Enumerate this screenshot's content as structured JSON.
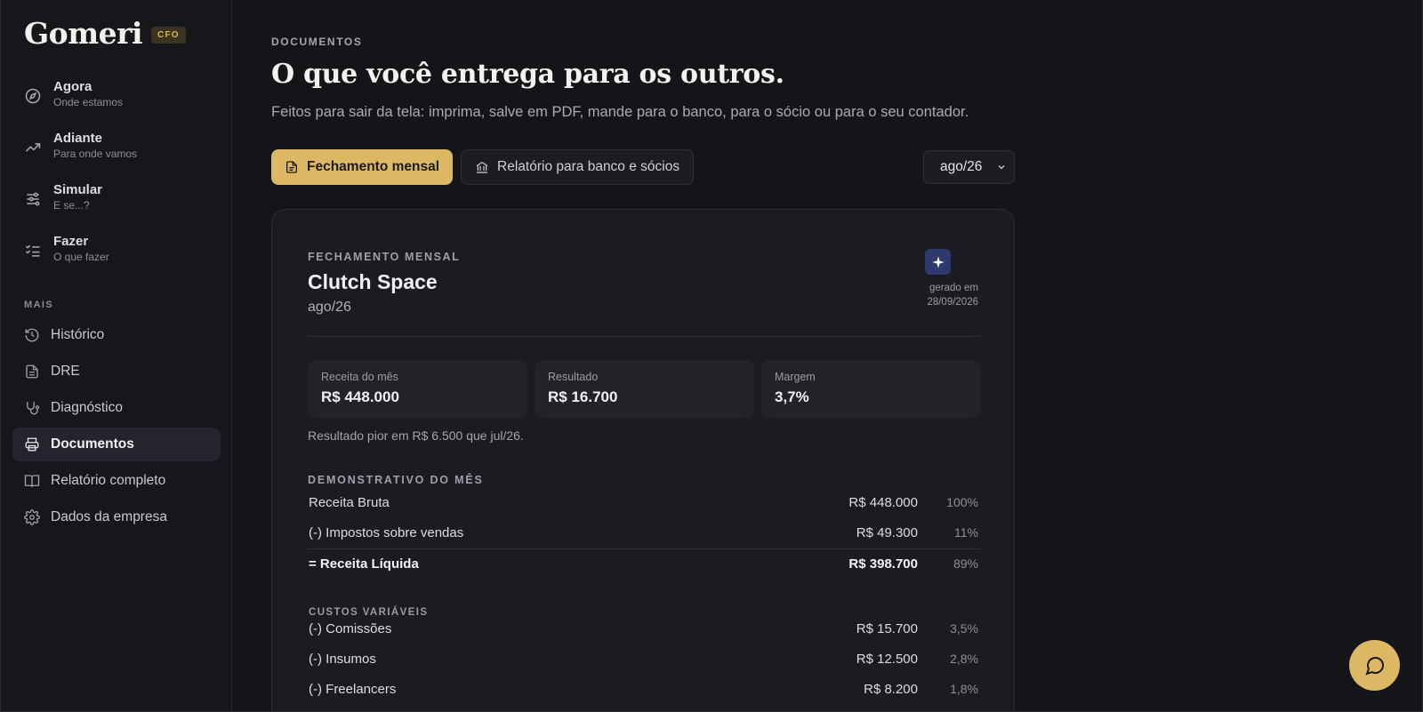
{
  "brand": {
    "name": "Gomeri",
    "badge": "CFO"
  },
  "nav_main": [
    {
      "title": "Agora",
      "subtitle": "Onde estamos",
      "icon": "compass-icon"
    },
    {
      "title": "Adiante",
      "subtitle": "Para onde vamos",
      "icon": "trending-up-icon"
    },
    {
      "title": "Simular",
      "subtitle": "E se...?",
      "icon": "sliders-icon"
    },
    {
      "title": "Fazer",
      "subtitle": "O que fazer",
      "icon": "checklist-icon"
    }
  ],
  "nav_section_label": "MAIS",
  "nav_secondary": [
    {
      "label": "Histórico",
      "icon": "history-icon",
      "active": false
    },
    {
      "label": "DRE",
      "icon": "file-text-icon",
      "active": false
    },
    {
      "label": "Diagnóstico",
      "icon": "stethoscope-icon",
      "active": false
    },
    {
      "label": "Documentos",
      "icon": "printer-icon",
      "active": true
    },
    {
      "label": "Relatório completo",
      "icon": "book-open-icon",
      "active": false
    },
    {
      "label": "Dados da empresa",
      "icon": "gear-icon",
      "active": false
    }
  ],
  "header": {
    "eyebrow": "DOCUMENTOS",
    "title": "O que você entrega para os outros.",
    "subtitle": "Feitos para sair da tela: imprima, salve em PDF, mande para o banco, para o sócio ou para o seu contador."
  },
  "tabs": [
    {
      "label": "Fechamento mensal",
      "icon": "file-icon",
      "active": true
    },
    {
      "label": "Relatório para banco e sócios",
      "icon": "bank-icon",
      "active": false
    }
  ],
  "month_select": {
    "value": "ago/26"
  },
  "card": {
    "eyebrow": "FECHAMENTO MENSAL",
    "company": "Clutch Space",
    "period": "ago/26",
    "generated_label": "gerado em",
    "generated_date": "28/09/2026",
    "kpis": [
      {
        "label": "Receita do mês",
        "value": "R$ 448.000"
      },
      {
        "label": "Resultado",
        "value": "R$ 16.700"
      },
      {
        "label": "Margem",
        "value": "3,7%"
      }
    ],
    "comparison": "Resultado pior em R$ 6.500 que jul/26.",
    "dre_title": "DEMONSTRATIVO DO MÊS",
    "dre_rows": [
      {
        "label": "Receita Bruta",
        "amount": "R$ 448.000",
        "pct": "100%"
      },
      {
        "label": "(-) Impostos sobre vendas",
        "amount": "R$ 49.300",
        "pct": "11%"
      },
      {
        "label": "= Receita Líquida",
        "amount": "R$ 398.700",
        "pct": "89%"
      }
    ],
    "variable_costs_label": "CUSTOS VARIÁVEIS",
    "variable_costs": [
      {
        "label": "(-) Comissões",
        "amount": "R$ 15.700",
        "pct": "3,5%"
      },
      {
        "label": "(-) Insumos",
        "amount": "R$ 12.500",
        "pct": "2,8%"
      },
      {
        "label": "(-) Freelancers",
        "amount": "R$ 8.200",
        "pct": "1,8%"
      }
    ]
  },
  "colors": {
    "accent": "#dcb865",
    "background": "#141519",
    "card": "#1b1c21",
    "spark": "#2e3a6e"
  }
}
